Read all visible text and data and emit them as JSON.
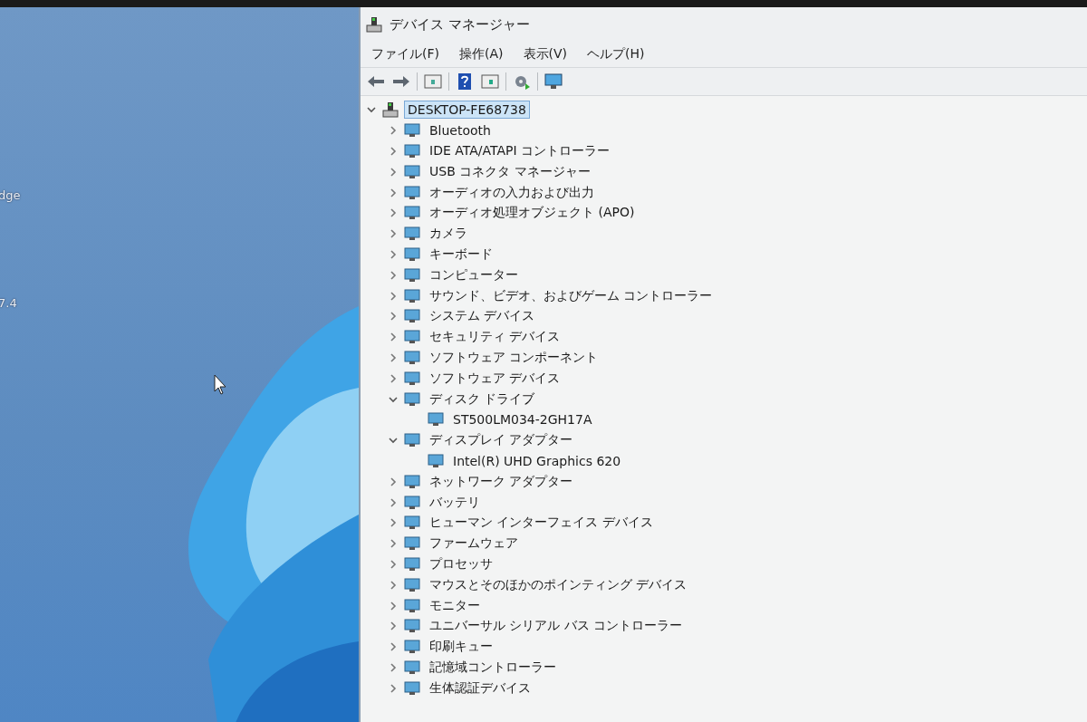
{
  "desktop": {
    "labels": [
      "dge",
      "7.4"
    ]
  },
  "window": {
    "title": "デバイス マネージャー"
  },
  "menu": [
    "ファイル(F)",
    "操作(A)",
    "表示(V)",
    "ヘルプ(H)"
  ],
  "tree": {
    "label": "DESKTOP-FE68738",
    "expanded": true,
    "selected": true,
    "children": [
      {
        "label": "Bluetooth",
        "expanded": false
      },
      {
        "label": "IDE ATA/ATAPI コントローラー",
        "expanded": false
      },
      {
        "label": "USB コネクタ マネージャー",
        "expanded": false
      },
      {
        "label": "オーディオの入力および出力",
        "expanded": false
      },
      {
        "label": "オーディオ処理オブジェクト (APO)",
        "expanded": false
      },
      {
        "label": "カメラ",
        "expanded": false
      },
      {
        "label": "キーボード",
        "expanded": false
      },
      {
        "label": "コンピューター",
        "expanded": false
      },
      {
        "label": "サウンド、ビデオ、およびゲーム コントローラー",
        "expanded": false
      },
      {
        "label": "システム デバイス",
        "expanded": false
      },
      {
        "label": "セキュリティ デバイス",
        "expanded": false
      },
      {
        "label": "ソフトウェア コンポーネント",
        "expanded": false
      },
      {
        "label": "ソフトウェア デバイス",
        "expanded": false
      },
      {
        "label": "ディスク ドライブ",
        "expanded": true,
        "children": [
          {
            "label": "ST500LM034-2GH17A"
          }
        ]
      },
      {
        "label": "ディスプレイ アダプター",
        "expanded": true,
        "children": [
          {
            "label": "Intel(R) UHD Graphics 620"
          }
        ]
      },
      {
        "label": "ネットワーク アダプター",
        "expanded": false
      },
      {
        "label": "バッテリ",
        "expanded": false
      },
      {
        "label": "ヒューマン インターフェイス デバイス",
        "expanded": false
      },
      {
        "label": "ファームウェア",
        "expanded": false
      },
      {
        "label": "プロセッサ",
        "expanded": false
      },
      {
        "label": "マウスとそのほかのポインティング デバイス",
        "expanded": false
      },
      {
        "label": "モニター",
        "expanded": false
      },
      {
        "label": "ユニバーサル シリアル バス コントローラー",
        "expanded": false
      },
      {
        "label": "印刷キュー",
        "expanded": false
      },
      {
        "label": "記憶域コントローラー",
        "expanded": false
      },
      {
        "label": "生体認証デバイス",
        "expanded": false
      }
    ]
  }
}
